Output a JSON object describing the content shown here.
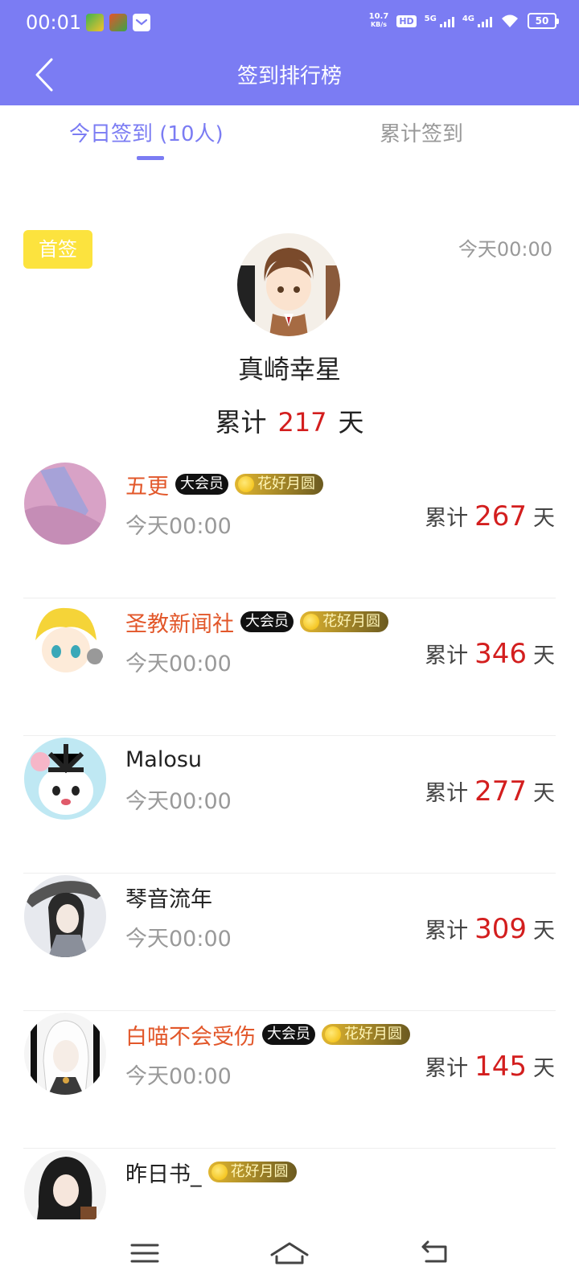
{
  "status_bar": {
    "time": "00:01",
    "net_speed_value": "10.7",
    "net_speed_unit": "KB/s",
    "hd_label": "HD",
    "sim1_label": "5G",
    "sim2_label": "4G",
    "battery": "50"
  },
  "title_bar": {
    "title": "签到排行榜"
  },
  "tabs": [
    {
      "label": "今日签到 (10人)",
      "active": true
    },
    {
      "label": "累计签到",
      "active": false
    }
  ],
  "first_sign": {
    "badge": "首签",
    "time": "今天00:00",
    "name": "真崎幸星",
    "total_prefix": "累计",
    "total_days": "217",
    "total_suffix": "天"
  },
  "list": [
    {
      "name": "五更",
      "vip": true,
      "vip_label": "大会员",
      "medal": "花好月圆",
      "time": "今天00:00",
      "prefix": "累计",
      "days": "267",
      "suffix": "天"
    },
    {
      "name": "圣教新闻社",
      "vip": true,
      "vip_label": "大会员",
      "medal": "花好月圆",
      "time": "今天00:00",
      "prefix": "累计",
      "days": "346",
      "suffix": "天"
    },
    {
      "name": "Malosu",
      "vip": false,
      "vip_label": "",
      "medal": "",
      "time": "今天00:00",
      "prefix": "累计",
      "days": "277",
      "suffix": "天"
    },
    {
      "name": "琴音流年",
      "vip": false,
      "vip_label": "",
      "medal": "",
      "time": "今天00:00",
      "prefix": "累计",
      "days": "309",
      "suffix": "天"
    },
    {
      "name": "白喵不会受伤",
      "vip": true,
      "vip_label": "大会员",
      "medal": "花好月圆",
      "time": "今天00:00",
      "prefix": "累计",
      "days": "145",
      "suffix": "天"
    },
    {
      "name": "昨日书_",
      "vip": false,
      "vip_label": "",
      "medal": "花好月圆",
      "time": "",
      "prefix": "",
      "days": "",
      "suffix": ""
    }
  ],
  "icons": {
    "back": "chevron-left-icon",
    "menu": "menu-icon",
    "home": "home-icon",
    "return": "back-arrow-icon"
  },
  "colors": {
    "header": "#7b7cf3",
    "accent": "#7b7cf3",
    "days_red": "#d31e1e",
    "vip_name": "#e2572a",
    "first_badge": "#fce33e"
  }
}
